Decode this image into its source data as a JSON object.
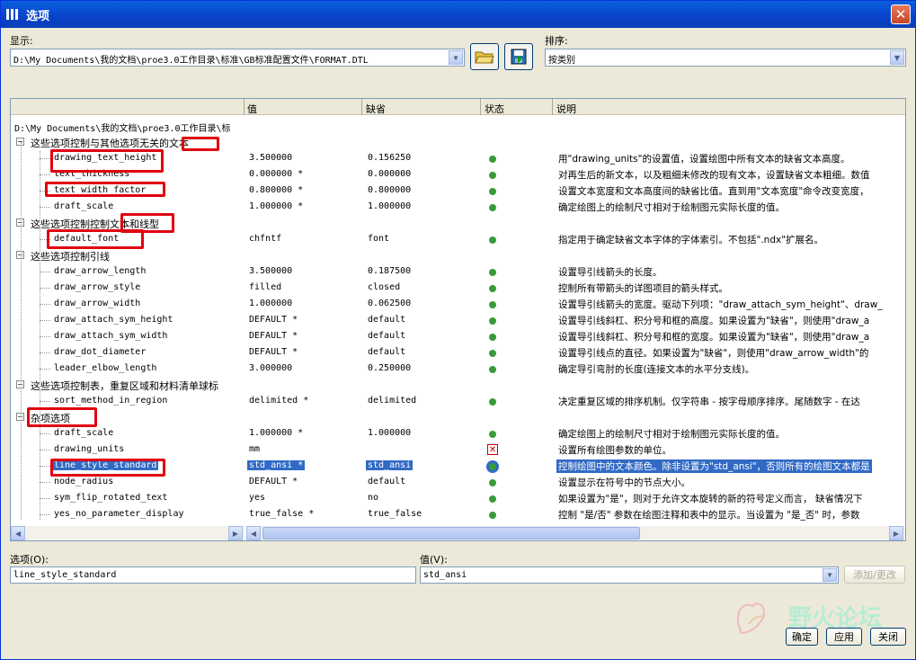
{
  "title": "选项",
  "display_label": "显示:",
  "display_value": "D:\\My Documents\\我的文档\\proe3.0工作目录\\标准\\GB标准配置文件\\FORMAT.DTL",
  "sort_label": "排序:",
  "sort_value": "按类别",
  "columns": {
    "name": "",
    "value": "值",
    "default": "缺省",
    "status": "状态",
    "desc": "说明"
  },
  "path_row": "D:\\My Documents\\我的文档\\proe3.0工作目录\\标",
  "rows": [
    {
      "kind": "group",
      "label": "这些选项控制与其他选项无关的文本"
    },
    {
      "kind": "item",
      "name": "drawing_text_height",
      "value": "3.500000",
      "default": "0.156250",
      "status": "ok",
      "desc": "用\"drawing_units\"的设置值，设置绘图中所有文本的缺省文本高度。"
    },
    {
      "kind": "item",
      "name": "text_thickness",
      "value": "0.000000 *",
      "default": "0.000000",
      "status": "ok",
      "desc": "对再生后的新文本，以及粗细未修改的现有文本，设置缺省文本粗细。数值"
    },
    {
      "kind": "item",
      "name": "text_width_factor",
      "value": "0.800000 *",
      "default": "0.800000",
      "status": "ok",
      "desc": "设置文本宽度和文本高度间的缺省比值。直到用\"文本宽度\"命令改变宽度，"
    },
    {
      "kind": "item",
      "name": "draft_scale",
      "value": "1.000000 *",
      "default": "1.000000",
      "status": "ok",
      "desc": "确定绘图上的绘制尺寸相对于绘制图元实际长度的值。"
    },
    {
      "kind": "group",
      "label": "这些选项控制控制文本和线型"
    },
    {
      "kind": "item",
      "name": "default_font",
      "value": "chfntf",
      "default": "font",
      "status": "ok",
      "desc": "指定用于确定缺省文本字体的字体索引。不包括\".ndx\"扩展名。"
    },
    {
      "kind": "group",
      "label": "这些选项控制引线"
    },
    {
      "kind": "item",
      "name": "draw_arrow_length",
      "value": "3.500000",
      "default": "0.187500",
      "status": "ok",
      "desc": "设置导引线箭头的长度。"
    },
    {
      "kind": "item",
      "name": "draw_arrow_style",
      "value": "filled",
      "default": "closed",
      "status": "ok",
      "desc": "控制所有带箭头的详图项目的箭头样式。"
    },
    {
      "kind": "item",
      "name": "draw_arrow_width",
      "value": "1.000000",
      "default": "0.062500",
      "status": "ok",
      "desc": "设置导引线箭头的宽度。驱动下列项：\"draw_attach_sym_height\"、draw_"
    },
    {
      "kind": "item",
      "name": "draw_attach_sym_height",
      "value": "DEFAULT *",
      "default": "default",
      "status": "ok",
      "desc": "设置导引线斜杠、积分号和框的高度。如果设置为\"缺省\"，则使用\"draw_a"
    },
    {
      "kind": "item",
      "name": "draw_attach_sym_width",
      "value": "DEFAULT *",
      "default": "default",
      "status": "ok",
      "desc": "设置导引线斜杠、积分号和框的宽度。如果设置为\"缺省\"，则使用\"draw_a"
    },
    {
      "kind": "item",
      "name": "draw_dot_diameter",
      "value": "DEFAULT *",
      "default": "default",
      "status": "ok",
      "desc": "设置导引线点的直径。如果设置为\"缺省\"，则使用\"draw_arrow_width\"的"
    },
    {
      "kind": "item",
      "name": "leader_elbow_length",
      "value": "3.000000",
      "default": "0.250000",
      "status": "ok",
      "desc": "确定导引弯肘的长度(连接文本的水平分支线)。"
    },
    {
      "kind": "group",
      "label": "这些选项控制表，重复区域和材料清单球标"
    },
    {
      "kind": "item",
      "name": "sort_method_in_region",
      "value": "delimited *",
      "default": "delimited",
      "status": "ok",
      "desc": "决定重复区域的排序机制。仅字符串 - 按字母顺序排序。尾随数字 - 在达"
    },
    {
      "kind": "group",
      "label": "杂项选项"
    },
    {
      "kind": "item",
      "name": "draft_scale",
      "value": "1.000000 *",
      "default": "1.000000",
      "status": "ok",
      "desc": "确定绘图上的绘制尺寸相对于绘制图元实际长度的值。"
    },
    {
      "kind": "item",
      "name": "drawing_units",
      "value": "mm",
      "default": "",
      "status": "error",
      "desc": "设置所有绘图参数的单位。"
    },
    {
      "kind": "item",
      "name": "line_style_standard",
      "value": "std_ansi *",
      "default": "std_ansi",
      "status": "ok",
      "desc": "控制绘图中的文本颜色。除非设置为\"std_ansi\"，否则所有的绘图文本都是",
      "selected": true
    },
    {
      "kind": "item",
      "name": "node_radius",
      "value": "DEFAULT *",
      "default": "default",
      "status": "ok",
      "desc": "设置显示在符号中的节点大小。"
    },
    {
      "kind": "item",
      "name": "sym_flip_rotated_text",
      "value": "yes",
      "default": "no",
      "status": "ok",
      "desc": "如果设置为\"是\"，则对于允许文本旋转的新的符号定义而言， 缺省情况下"
    },
    {
      "kind": "item",
      "name": "yes_no_parameter_display",
      "value": "true_false *",
      "default": "true_false",
      "status": "ok",
      "desc": "控制 \"是/否\" 参数在绘图注释和表中的显示。当设置为 \"是_否\" 时，参数"
    }
  ],
  "option_label": "选项(O):",
  "option_value": "line_style_standard",
  "value_label": "值(V):",
  "value_value": "std_ansi",
  "add_change_label": "添加/更改",
  "ok_label": "确定",
  "apply_label": "应用",
  "close_label": "关闭",
  "watermark_text": "野火论坛",
  "colors": {
    "title_bar": "#0842c8",
    "status_ok": "#3a9a3a",
    "status_error": "#cc0000",
    "highlight": "#e00010",
    "selection": "#316ac5"
  }
}
